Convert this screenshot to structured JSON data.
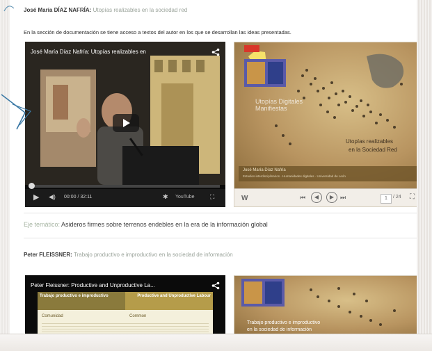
{
  "section1": {
    "author": "José María DÍAZ NAFRÍA:",
    "subtitle": "Utopías realizables en la sociedad red"
  },
  "intro_text": "En la sección de documentación se tiene acceso a textos del autor en los que se desarrollan las ideas presentadas.",
  "video1": {
    "title": "José María Díaz Nafría: Utopías realizables en",
    "time": "00:00 / 32:11",
    "youtube_label": "YouTube",
    "progress": 0.0
  },
  "slides1": {
    "title_line1": "Utopías realizables",
    "title_line2": "en la Sociedad Red",
    "caption_name": "José María Díaz Nafría",
    "caption_sub": "Estudios interdisciplinarios · Humanidades digitales · Universidad de León",
    "slide_label": "Utopías Digitales Manifiestas",
    "page": "1",
    "page_total": "/ 24"
  },
  "eje": {
    "label": "Eje temático:",
    "text": "Asideros firmes sobre terrenos endebles en la era de la información global"
  },
  "section2": {
    "author": "Peter FLEISSNER:",
    "subtitle": "Trabajo productivo e improductivo en la sociedad de información"
  },
  "video2": {
    "title": "Peter Fleissner: Productive and Unproductive La...",
    "col1_header": "Trabajo productivo e improductivo",
    "col2_header": "Productive and Unproductive Labour",
    "col1_sub": "Comunidad",
    "col2_sub": "Common"
  },
  "slides2": {
    "title_line1": "Trabajo productivo e improductivo",
    "title_line2": "en la sociedad de información"
  },
  "colors": {
    "accent_green": "#a7b5a3",
    "video_bg": "#0b0b0b",
    "slides_gold": "#c8a86e",
    "slide_header": "#8a7a3c"
  }
}
